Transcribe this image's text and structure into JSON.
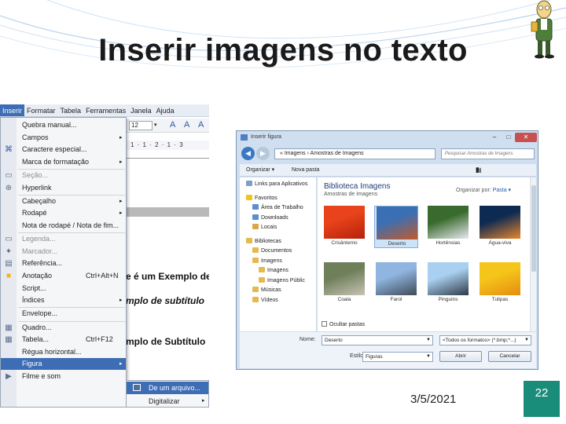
{
  "slide": {
    "title": "Inserir imagens no texto",
    "date": "3/5/2021",
    "page_number": "22"
  },
  "colors": {
    "accent_teal": "#1a8c7a",
    "menu_highlight": "#3d6db5",
    "dialog_frame": "#cfdff0"
  },
  "writer": {
    "menubar": [
      "Inserir",
      "Formatar",
      "Tabela",
      "Ferramentas",
      "Janela",
      "Ajuda"
    ],
    "toolbar_fontsize": "12",
    "ruler_text": "1 · 1 · 2 · 1 · 3",
    "doc_line1": "e é um Exemplo de",
    "doc_line2": "mplo de subtítulo",
    "doc_line3": "mplo de Subtítulo",
    "menu_items": [
      {
        "label": "Quebra manual...",
        "shortcut": "",
        "submenu": false,
        "disabled": false,
        "icon": ""
      },
      {
        "label": "Campos",
        "shortcut": "",
        "submenu": true,
        "disabled": false,
        "icon": ""
      },
      {
        "label": "Caractere especial...",
        "shortcut": "",
        "submenu": false,
        "disabled": false,
        "icon": "special-char-icon"
      },
      {
        "label": "Marca de formatação",
        "shortcut": "",
        "submenu": true,
        "disabled": false,
        "icon": ""
      },
      {
        "label": "Seção...",
        "shortcut": "",
        "submenu": false,
        "disabled": true,
        "icon": "section-icon"
      },
      {
        "label": "Hyperlink",
        "shortcut": "",
        "submenu": false,
        "disabled": false,
        "icon": "hyperlink-icon"
      },
      {
        "label": "Cabeçalho",
        "shortcut": "",
        "submenu": true,
        "disabled": false,
        "icon": ""
      },
      {
        "label": "Rodapé",
        "shortcut": "",
        "submenu": true,
        "disabled": false,
        "icon": ""
      },
      {
        "label": "Nota de rodapé / Nota de fim...",
        "shortcut": "",
        "submenu": false,
        "disabled": false,
        "icon": ""
      },
      {
        "label": "Legenda...",
        "shortcut": "",
        "submenu": false,
        "disabled": true,
        "icon": "caption-icon"
      },
      {
        "label": "Marcador...",
        "shortcut": "",
        "submenu": false,
        "disabled": true,
        "icon": "bookmark-icon"
      },
      {
        "label": "Referência...",
        "shortcut": "",
        "submenu": false,
        "disabled": false,
        "icon": "reference-icon"
      },
      {
        "label": "Anotação",
        "shortcut": "Ctrl+Alt+N",
        "submenu": false,
        "disabled": false,
        "icon": "comment-icon"
      },
      {
        "label": "Script...",
        "shortcut": "",
        "submenu": false,
        "disabled": false,
        "icon": ""
      },
      {
        "label": "Índices",
        "shortcut": "",
        "submenu": true,
        "disabled": false,
        "icon": ""
      },
      {
        "label": "Envelope...",
        "shortcut": "",
        "submenu": false,
        "disabled": false,
        "icon": ""
      },
      {
        "label": "Quadro...",
        "shortcut": "",
        "submenu": false,
        "disabled": false,
        "icon": "frame-icon"
      },
      {
        "label": "Tabela...",
        "shortcut": "Ctrl+F12",
        "submenu": false,
        "disabled": false,
        "icon": "table-icon"
      },
      {
        "label": "Régua horizontal...",
        "shortcut": "",
        "submenu": false,
        "disabled": false,
        "icon": ""
      },
      {
        "label": "Figura",
        "shortcut": "",
        "submenu": true,
        "disabled": false,
        "icon": ""
      },
      {
        "label": "Filme e som",
        "shortcut": "",
        "submenu": false,
        "disabled": false,
        "icon": "movie-icon"
      }
    ],
    "submenu_items": [
      "De um arquivo...",
      "Digitalizar"
    ]
  },
  "dialog": {
    "title": "Inserir figura",
    "address": "« Imagens › Amostras de Imagens",
    "search_placeholder": "Pesquisar Amostras de Imagens",
    "organize": "Organizar ▾",
    "new_folder": "Nova pasta",
    "nav_items": [
      {
        "label": "Links para Aplicativos",
        "indent": 0,
        "color": "#7da0c9"
      },
      {
        "label": "Favoritos",
        "indent": 0,
        "color": "#f0c419"
      },
      {
        "label": "Área de Trabalho",
        "indent": 1,
        "color": "#5a8fd1"
      },
      {
        "label": "Downloads",
        "indent": 1,
        "color": "#5a8fd1"
      },
      {
        "label": "Locais",
        "indent": 1,
        "color": "#d9a84a"
      },
      {
        "label": "Bibliotecas",
        "indent": 0,
        "color": "#e5b94d"
      },
      {
        "label": "Documentos",
        "indent": 1,
        "color": "#e5b94d"
      },
      {
        "label": "Imagens",
        "indent": 1,
        "color": "#e5b94d"
      },
      {
        "label": "Imagens",
        "indent": 2,
        "color": "#e5b94d"
      },
      {
        "label": "Imagens Públic",
        "indent": 2,
        "color": "#e5b94d"
      },
      {
        "label": "Músicas",
        "indent": 1,
        "color": "#e5b94d"
      },
      {
        "label": "Vídeos",
        "indent": 1,
        "color": "#e5b94d"
      }
    ],
    "library_title": "Biblioteca Imagens",
    "library_subtitle": "Amostras de Imagens",
    "arrange_label": "Organizar por:",
    "arrange_value": "Pasta ▾",
    "thumbnails": [
      {
        "caption": "Crisântemo",
        "colors": [
          "#e8431a",
          "#b5200c"
        ]
      },
      {
        "caption": "Deserto",
        "colors": [
          "#3b6fb3",
          "#c15a2a"
        ],
        "selected": true
      },
      {
        "caption": "Hortênsias",
        "colors": [
          "#3a6b2e",
          "#e8e8f0"
        ]
      },
      {
        "caption": "Água-viva",
        "colors": [
          "#0d2a52",
          "#e8872d"
        ]
      },
      {
        "caption": "Coala",
        "colors": [
          "#6f7f5a",
          "#c9c3b6"
        ]
      },
      {
        "caption": "Farol",
        "colors": [
          "#8fb5e0",
          "#3f4a55"
        ]
      },
      {
        "caption": "Pinguins",
        "colors": [
          "#a9d0f0",
          "#2f3945"
        ]
      },
      {
        "caption": "Tulipas",
        "colors": [
          "#f5c51a",
          "#e48d0f"
        ]
      }
    ],
    "hide_folders": "Ocultar pastas",
    "name_label": "Nome:",
    "name_value": "Deserto",
    "style_label": "Estilo:",
    "style_value": "Figuras",
    "filetype_value": "<Todos os formatos> (*.bmp;*...)",
    "open_button": "Abrir",
    "cancel_button": "Cancelar"
  }
}
